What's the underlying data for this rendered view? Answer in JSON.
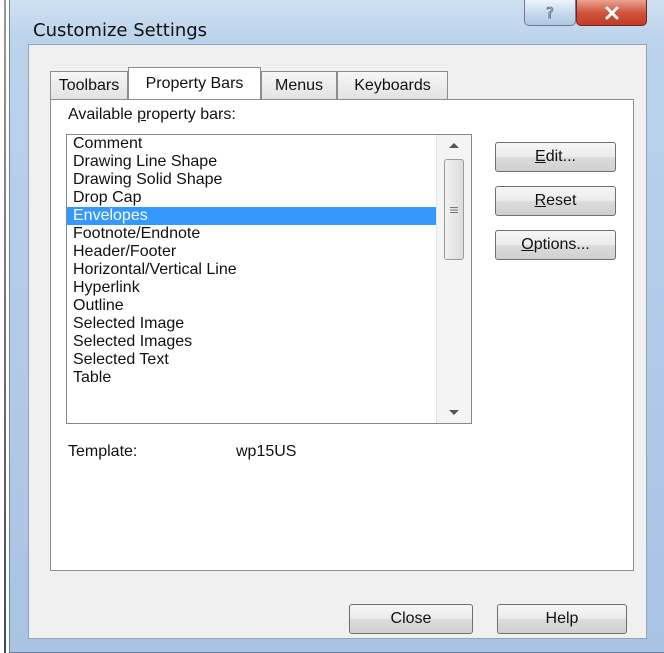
{
  "window": {
    "title": "Customize Settings",
    "help_glyph": "?",
    "close_glyph": "✕"
  },
  "tabs": [
    {
      "label": "Toolbars",
      "active": false
    },
    {
      "label": "Property Bars",
      "active": true
    },
    {
      "label": "Menus",
      "active": false
    },
    {
      "label": "Keyboards",
      "active": false
    }
  ],
  "panel": {
    "list_label_pre": "Available ",
    "list_label_mnemonic": "p",
    "list_label_post": "roperty bars:",
    "items": [
      "Comment",
      "Drawing Line Shape",
      "Drawing Solid Shape",
      "Drop Cap",
      "Envelopes",
      "Footnote/Endnote",
      "Header/Footer",
      "Horizontal/Vertical Line",
      "Hyperlink",
      "Outline",
      "Selected Image",
      "Selected Images",
      "Selected Text",
      "Table"
    ],
    "selected_item": "Envelopes",
    "template_label": "Template:",
    "template_value": "wp15US",
    "buttons": {
      "edit_mnemonic": "E",
      "edit_rest": "dit...",
      "reset_mnemonic": "R",
      "reset_rest": "eset",
      "options_mnemonic": "O",
      "options_rest": "ptions..."
    }
  },
  "footer": {
    "close_label": "Close",
    "help_label": "Help"
  },
  "colors": {
    "selection": "#3399ff",
    "close_button": "#c94b33",
    "frame": "#b4cce8"
  }
}
